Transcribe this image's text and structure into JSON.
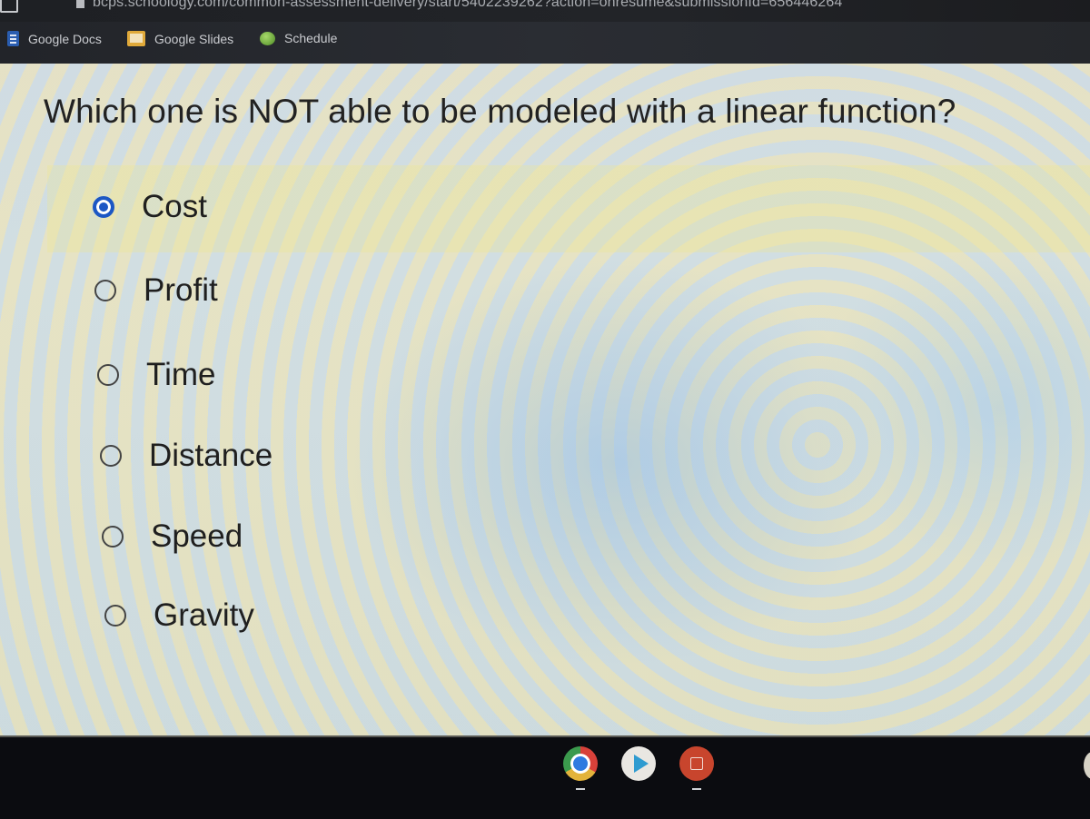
{
  "browser": {
    "url": "bcps.schoology.com/common-assessment-delivery/start/5402239262?action=onresume&submissionId=656446264",
    "bookmarks": [
      {
        "label": "Google Docs",
        "icon": "google-docs-icon"
      },
      {
        "label": "Google Slides",
        "icon": "google-slides-icon"
      },
      {
        "label": "Schedule",
        "icon": "schedule-icon"
      }
    ]
  },
  "quiz": {
    "question": "Which one is NOT able to be modeled with a linear function?",
    "selected_index": 0,
    "options": [
      {
        "label": "Cost",
        "selected": true
      },
      {
        "label": "Profit",
        "selected": false
      },
      {
        "label": "Time",
        "selected": false
      },
      {
        "label": "Distance",
        "selected": false
      },
      {
        "label": "Speed",
        "selected": false
      },
      {
        "label": "Gravity",
        "selected": false
      }
    ],
    "accent_color": "#1c57c4"
  },
  "shelf": {
    "apps": [
      {
        "name": "Chrome",
        "icon": "chrome-icon"
      },
      {
        "name": "Play Store",
        "icon": "play-store-icon"
      },
      {
        "name": "Gallery",
        "icon": "gallery-icon"
      }
    ]
  }
}
